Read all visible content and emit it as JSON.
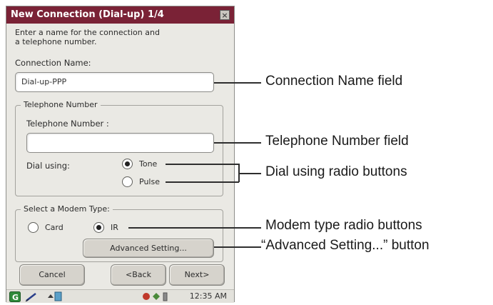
{
  "dialog": {
    "title": "New Connection (Dial-up) 1/4",
    "close_label": "×",
    "instructions_line1": "Enter a name for the connection and",
    "instructions_line2": "a telephone number.",
    "connection_name_label": "Connection Name:",
    "connection_name_value": "Dial-up-PPP",
    "telephone_group_legend": "Telephone Number",
    "telephone_number_label": "Telephone Number :",
    "telephone_number_value": "",
    "dial_using_label": "Dial using:",
    "dial_options": [
      {
        "label": "Tone",
        "selected": true
      },
      {
        "label": "Pulse",
        "selected": false
      }
    ],
    "modem_group_legend": "Select a Modem Type:",
    "modem_options": [
      {
        "label": "Card",
        "selected": false
      },
      {
        "label": "IR",
        "selected": true
      }
    ],
    "advanced_button": "Advanced Setting...",
    "cancel_button": "Cancel",
    "back_button": "<Back",
    "next_button": "Next>"
  },
  "taskbar": {
    "clock": "12:35 AM"
  },
  "callouts": {
    "connection_name": "Connection Name field",
    "telephone_number": "Telephone Number field",
    "dial_using": "Dial using radio buttons",
    "modem_type": "Modem type radio buttons",
    "advanced_setting": "“Advanced Setting...” button"
  },
  "colors": {
    "titlebar": "#7a2236",
    "dialog_bg": "#eae9e4"
  }
}
